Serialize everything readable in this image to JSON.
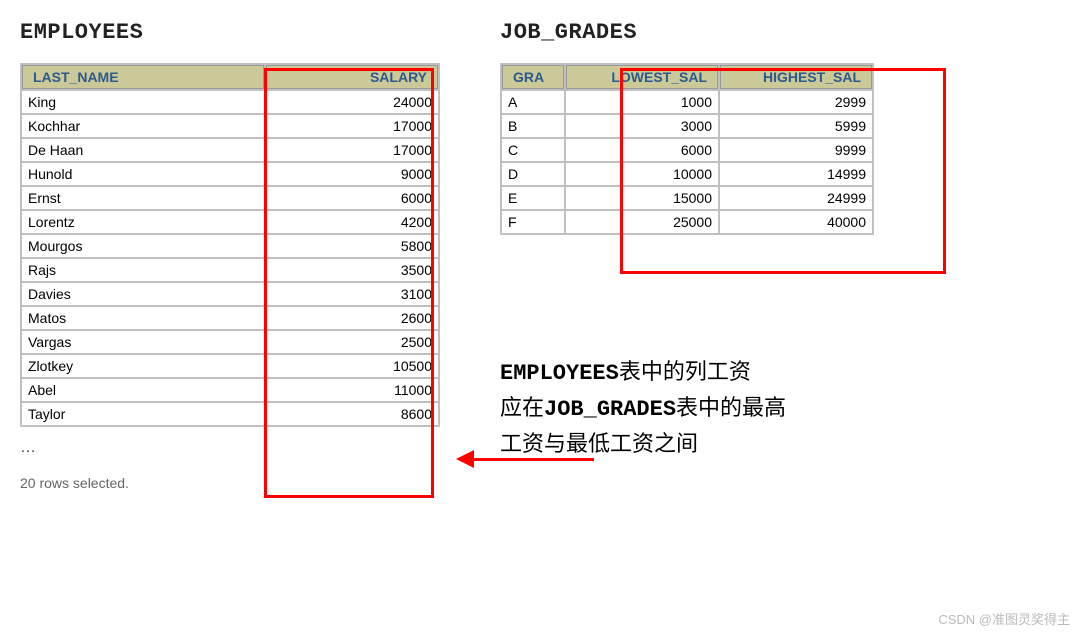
{
  "employees": {
    "title": "EMPLOYEES",
    "headers": {
      "name": "LAST_NAME",
      "salary": "SALARY"
    },
    "rows": [
      {
        "name": "King",
        "salary": "24000"
      },
      {
        "name": "Kochhar",
        "salary": "17000"
      },
      {
        "name": "De Haan",
        "salary": "17000"
      },
      {
        "name": "Hunold",
        "salary": "9000"
      },
      {
        "name": "Ernst",
        "salary": "6000"
      },
      {
        "name": "Lorentz",
        "salary": "4200"
      },
      {
        "name": "Mourgos",
        "salary": "5800"
      },
      {
        "name": "Rajs",
        "salary": "3500"
      },
      {
        "name": "Davies",
        "salary": "3100"
      },
      {
        "name": "Matos",
        "salary": "2600"
      },
      {
        "name": "Vargas",
        "salary": "2500"
      },
      {
        "name": "Zlotkey",
        "salary": "10500"
      },
      {
        "name": "Abel",
        "salary": "11000"
      },
      {
        "name": "Taylor",
        "salary": "8600"
      }
    ],
    "ellipsis": "…",
    "status": "20 rows selected."
  },
  "grades": {
    "title": "JOB_GRADES",
    "headers": {
      "gra": "GRA",
      "low": "LOWEST_SAL",
      "high": "HIGHEST_SAL"
    },
    "rows": [
      {
        "gra": "A",
        "low": "1000",
        "high": "2999"
      },
      {
        "gra": "B",
        "low": "3000",
        "high": "5999"
      },
      {
        "gra": "C",
        "low": "6000",
        "high": "9999"
      },
      {
        "gra": "D",
        "low": "10000",
        "high": "14999"
      },
      {
        "gra": "E",
        "low": "15000",
        "high": "24999"
      },
      {
        "gra": "F",
        "low": "25000",
        "high": "40000"
      }
    ]
  },
  "note": {
    "line1a": "EMPLOYEES",
    "line1b": "表中的列工资",
    "line2a": "应在",
    "line2b": "JOB_GRADES",
    "line2c": "表中的最高",
    "line3": "工资与最低工资之间"
  },
  "watermark": "CSDN @准图灵奖得主"
}
